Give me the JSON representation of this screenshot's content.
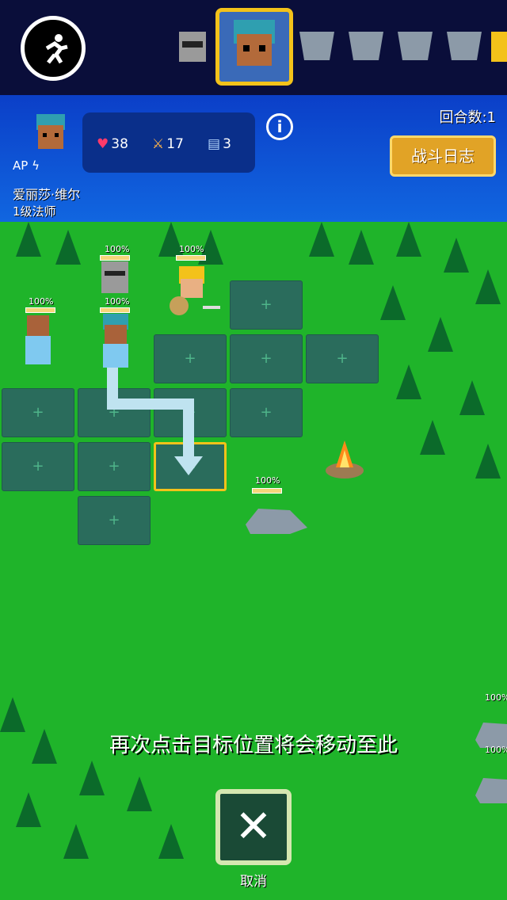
{
  "turn_order": {
    "portraits": [
      "knight-icon",
      "mage-icon",
      "wolf-icon",
      "wolf-icon",
      "wolf-icon",
      "wolf-icon",
      "hero-icon"
    ]
  },
  "hero": {
    "name": "爱丽莎·维尔",
    "level_class": "1级法师",
    "ap_label": "AP ϟ",
    "hp": "38",
    "attack": "17",
    "defense": "3"
  },
  "round_label": "回合数:1",
  "battle_log_label": "战斗日志",
  "info_label": "i",
  "hint_text": "再次点击目标位置将会移动至此",
  "cancel_label": "取消",
  "hp_percent": "100%",
  "colors": {
    "accent": "#e1a326",
    "sky": "#0b3fc8",
    "grass": "#1fb42a"
  }
}
